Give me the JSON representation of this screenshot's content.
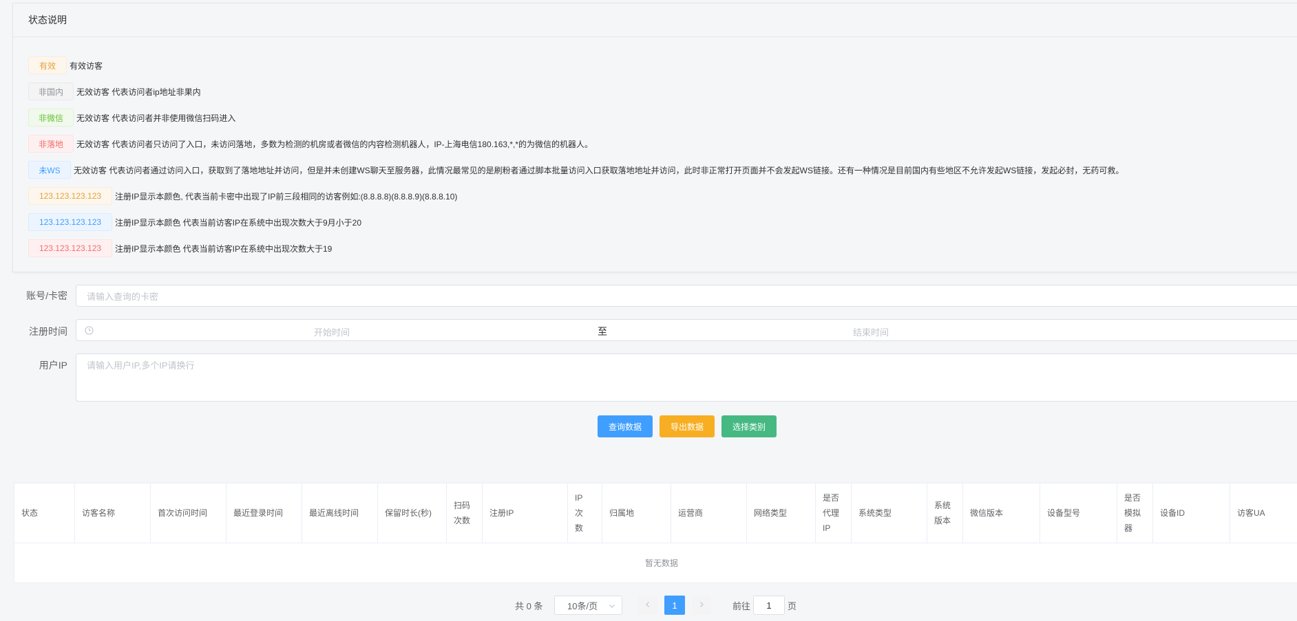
{
  "status_card": {
    "title": "状态说明",
    "legend": [
      {
        "tag": "有效",
        "desc": "有效访客"
      },
      {
        "tag": "非国内",
        "desc": "无效访客 代表访问者ip地址非果内"
      },
      {
        "tag": "非微信",
        "desc": "无效访客 代表访问者并非使用微信扫码进入"
      },
      {
        "tag": "非落地",
        "desc": "无效访客 代表访问者只访问了入口，未访问落地，多数为检测的机房或者微信的内容检测机器人，IP-上海电信180.163,*,*的为微信的机器人。"
      },
      {
        "tag": "未WS",
        "desc": "无效访客 代表访问者通过访问入口，获取到了落地地址并访问，但是并未创建WS聊天至服务器，此情况最常见的是刷粉者通过脚本批量访问入口获取落地地址并访问，此时非正常打开页面并不会发起WS链接。还有一种情况是目前国内有些地区不允许发起WS链接，发起必封，无药可救。"
      },
      {
        "tag": "123.123.123.123",
        "desc": "注册IP显示本颜色, 代表当前卡密中出现了IP前三段相同的访客例如:(8.8.8.8)(8.8.8.9)(8.8.8.10)"
      },
      {
        "tag": "123.123.123.123",
        "desc": "注册IP显示本颜色 代表当前访客IP在系统中出现次数大于9月小于20"
      },
      {
        "tag": "123.123.123.123",
        "desc": "注册IP显示本颜色 代表当前访客IP在系统中出现次数大于19"
      }
    ]
  },
  "form": {
    "account_label": "账号/卡密",
    "account_placeholder": "请输入查询的卡密",
    "time_label": "注册时间",
    "start_placeholder": "开始时间",
    "range_sep": "至",
    "end_placeholder": "结束时间",
    "ip_label": "用户IP",
    "ip_placeholder": "请输入用户IP,多个IP请换行"
  },
  "buttons": {
    "query": "查询数据",
    "export": "导出数据",
    "category": "选择类别"
  },
  "colors": {
    "primary": "#409eff",
    "warning": "#f7ae22",
    "success": "#46b983"
  },
  "table": {
    "headers": [
      "状态",
      "访客名称",
      "首次访问时间",
      "最近登录时间",
      "最近离线时间",
      "保留时长(秒)",
      "扫码次数",
      "注册IP",
      "IP次数",
      "归属地",
      "运营商",
      "网络类型",
      "是否代理IP",
      "系统类型",
      "系统版本",
      "微信版本",
      "设备型号",
      "是否模拟器",
      "设备ID",
      "访客UA"
    ],
    "empty_text": "暂无数据"
  },
  "pagination": {
    "total": "共 0 条",
    "page_size": "10条/页",
    "current_page": "1",
    "goto_label": "前往",
    "goto_value": "1",
    "page_unit": "页"
  },
  "icons": {
    "clock": "clock-icon",
    "chevron_down": "chevron-down-icon",
    "prev": "chevron-left-icon",
    "next": "chevron-right-icon"
  }
}
